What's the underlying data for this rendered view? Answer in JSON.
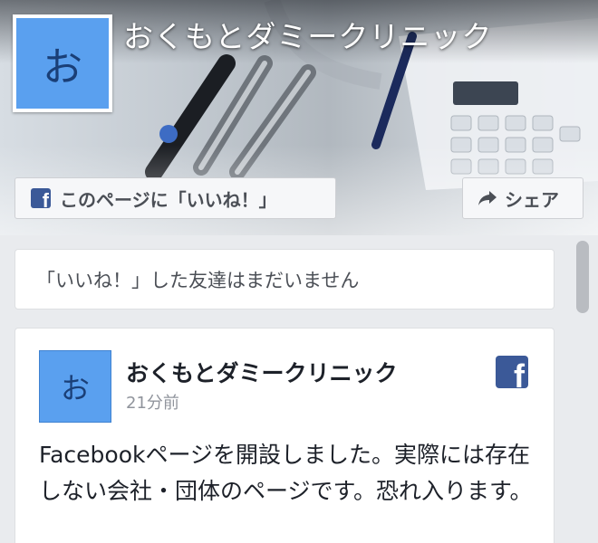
{
  "page": {
    "name": "おくもとダミークリニック",
    "avatar_initial": "お"
  },
  "actions": {
    "like_label": "このページに「いいね！」",
    "share_label": "シェア"
  },
  "friends": {
    "text": "「いいね！」した友達はまだいません"
  },
  "post": {
    "author": "おくもとダミークリニック",
    "avatar_initial": "お",
    "time": "21分前",
    "body": "Facebookページを開設しました。実際には存在しない会社・団体のページです。恐れ入ります。"
  },
  "icons": {
    "facebook": "facebook-icon",
    "share": "share-arrow-icon",
    "fb_letter": "f"
  },
  "colors": {
    "facebook_blue": "#3b5998",
    "avatar_blue": "#5aa0ef"
  }
}
